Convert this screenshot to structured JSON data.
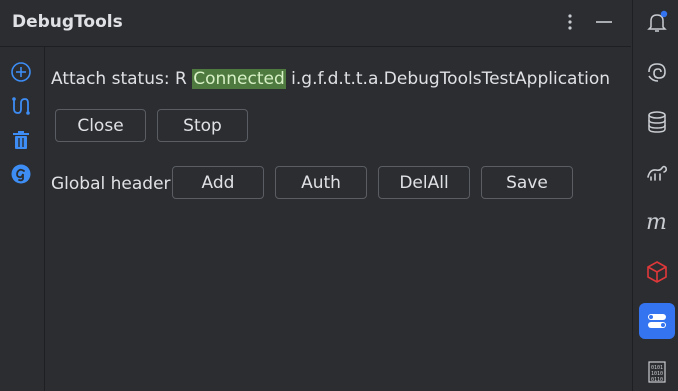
{
  "window": {
    "title": "DebugTools"
  },
  "status": {
    "prefix": "Attach status: R",
    "state": "Connected",
    "app": "i.g.f.d.t.t.a.DebugToolsTestApplication"
  },
  "actions": {
    "close_label": "Close",
    "stop_label": "Stop"
  },
  "global_header": {
    "label": "Global header:",
    "add_label": "Add",
    "auth_label": "Auth",
    "delall_label": "DelAll",
    "save_label": "Save"
  },
  "colors": {
    "connected_bg": "#4e7a3f",
    "accent": "#3574f0",
    "left_icon_blue": "#3d8df5",
    "notification_dot": "#3574f0",
    "redis_red": "#e0383a"
  },
  "icons": {
    "left": [
      "add-circle-icon",
      "debug-flow-icon",
      "trash-icon",
      "groovy-icon"
    ],
    "right": [
      "notifications-icon",
      "ai-assistant-icon",
      "database-icon",
      "gradle-icon",
      "maven-icon",
      "redis-icon",
      "debugtools-icon",
      "binary-icon"
    ]
  }
}
